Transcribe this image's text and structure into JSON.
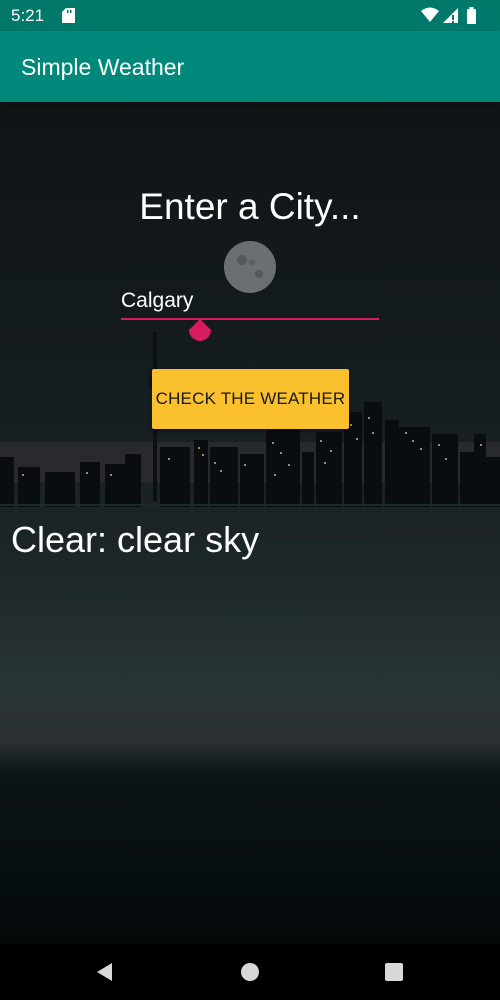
{
  "status_bar": {
    "time": "5:21",
    "icons": [
      "sd-card-icon",
      "wifi-icon",
      "signal-icon",
      "battery-icon"
    ]
  },
  "app_bar": {
    "title": "Simple Weather"
  },
  "main": {
    "heading": "Enter a City...",
    "city_input": {
      "value": "Calgary",
      "placeholder": ""
    },
    "check_button_label": "CHECK THE WEATHER",
    "result": "Clear: clear sky"
  },
  "navigation_bar": {
    "buttons": [
      "back-icon",
      "home-icon",
      "recents-icon"
    ]
  },
  "colors": {
    "status_bar": "#00796b",
    "app_bar": "#00897b",
    "accent": "#d81b60",
    "button": "#fbc02d"
  }
}
